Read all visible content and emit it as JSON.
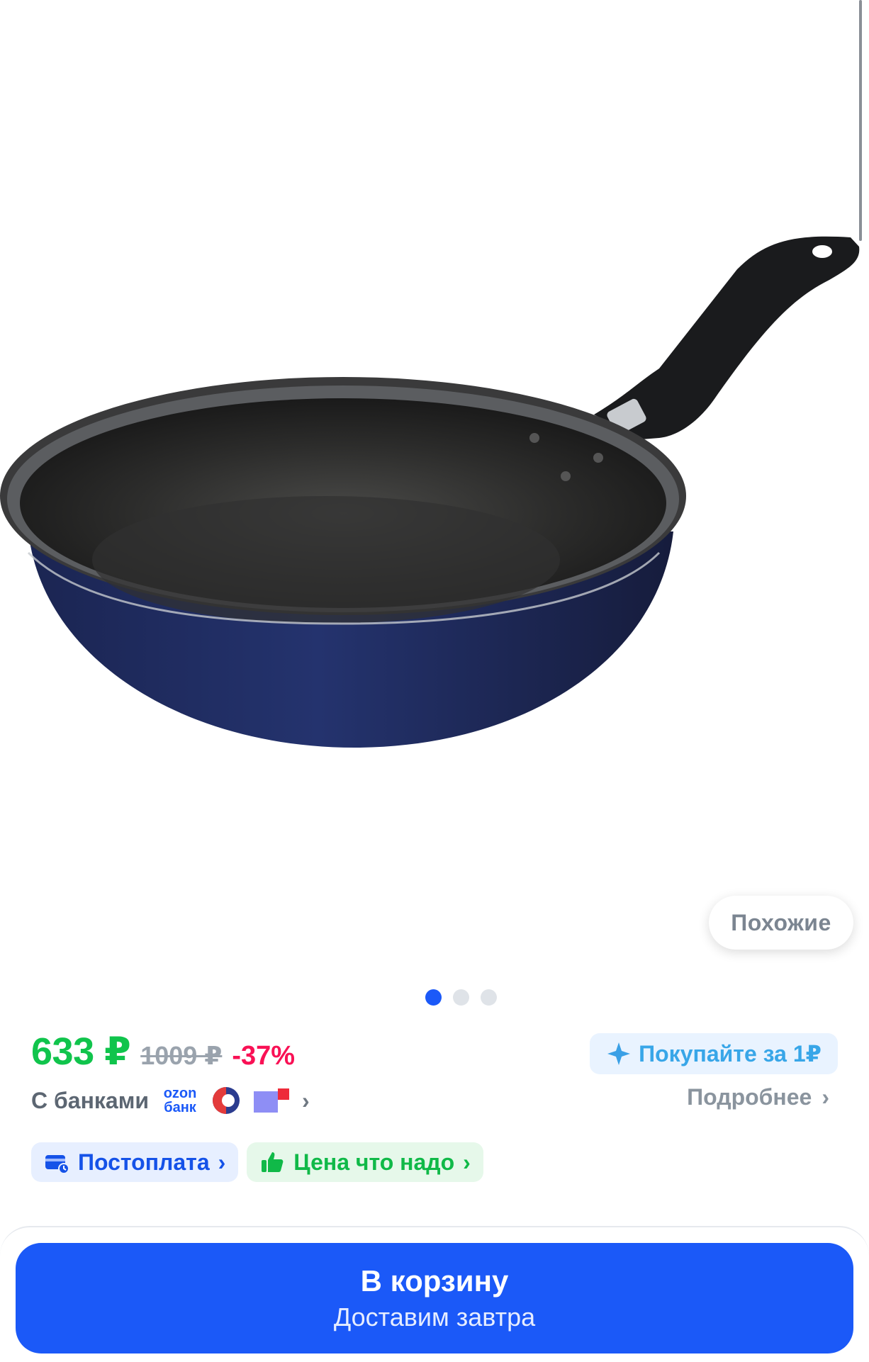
{
  "product": {
    "image_alt": "frying-pan",
    "similar_label": "Похожие",
    "gallery_dots": 3,
    "gallery_active": 1
  },
  "price": {
    "current": "633 ₽",
    "old": "1009 ₽",
    "discount": "-37%"
  },
  "promo": {
    "buy_for_1": "Покупайте за 1₽",
    "banks_label": "С банками",
    "ozon_bank_line1": "ozon",
    "ozon_bank_line2": "банк",
    "details": "Подробнее"
  },
  "badges": {
    "postpay": "Постоплата",
    "fair_price": "Цена что надо"
  },
  "cart": {
    "button_label": "В корзину",
    "delivery": "Доставим завтра"
  },
  "colors": {
    "accent": "#1b59f8",
    "price_green": "#10c44c",
    "discount_red": "#f91155"
  }
}
